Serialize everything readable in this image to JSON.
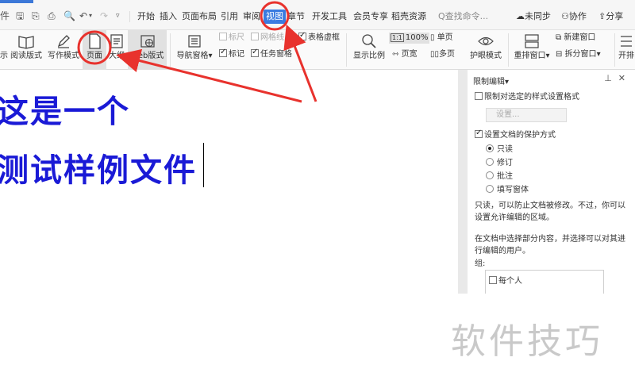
{
  "quick_access": {
    "file_fragment": "件"
  },
  "menu_tabs": [
    "开始",
    "插入",
    "页面布局",
    "引用",
    "审阅",
    "视图",
    "章节",
    "开发工具",
    "会员专享",
    "稻壳资源"
  ],
  "active_tab": "视图",
  "search": {
    "placeholder": "Q查找命令..."
  },
  "top_right": {
    "sync": "未同步",
    "collab": "协作",
    "share": "分享"
  },
  "ribbon": {
    "left_fragment": "示",
    "reading_mode": "阅读版式",
    "writing_mode": "写作模式",
    "page": "页面",
    "outline": "大纲",
    "web_layout": "Web版式",
    "nav_pane": "导航窗格",
    "ruler": "标尺",
    "gridlines": "网格线",
    "table_gridlines": "表格虚框",
    "marks": "标记",
    "task_pane": "任务窗格",
    "zoom": "显示比例",
    "zoom_100": "100%",
    "single_page": "单页",
    "page_width": "页宽",
    "multi_page": "多页",
    "eye_protect": "护眼模式",
    "rearrange_windows": "重排窗口",
    "new_window": "新建窗口",
    "split_window": "拆分窗口",
    "arrange_fragment": "开排"
  },
  "document": {
    "line1": "这是一个",
    "line2": "测试样例文件"
  },
  "panel": {
    "title": "限制编辑",
    "restrict_format": "限制对选定的样式设置格式",
    "settings_button": "设置...",
    "protect_doc": "设置文档的保护方式",
    "options": [
      "只读",
      "修订",
      "批注",
      "填写窗体"
    ],
    "selected_option": "只读",
    "desc1": "只读，可以防止文档被修改。不过，你可以设置允许编辑的区域。",
    "desc2": "在文档中选择部分内容，并选择可以对其进行编辑的用户。",
    "group_label": "组:",
    "everyone": "每个人"
  },
  "watermark": "软件技巧",
  "annotation_color": "#e8322d",
  "accent_color": "#3a7be0"
}
